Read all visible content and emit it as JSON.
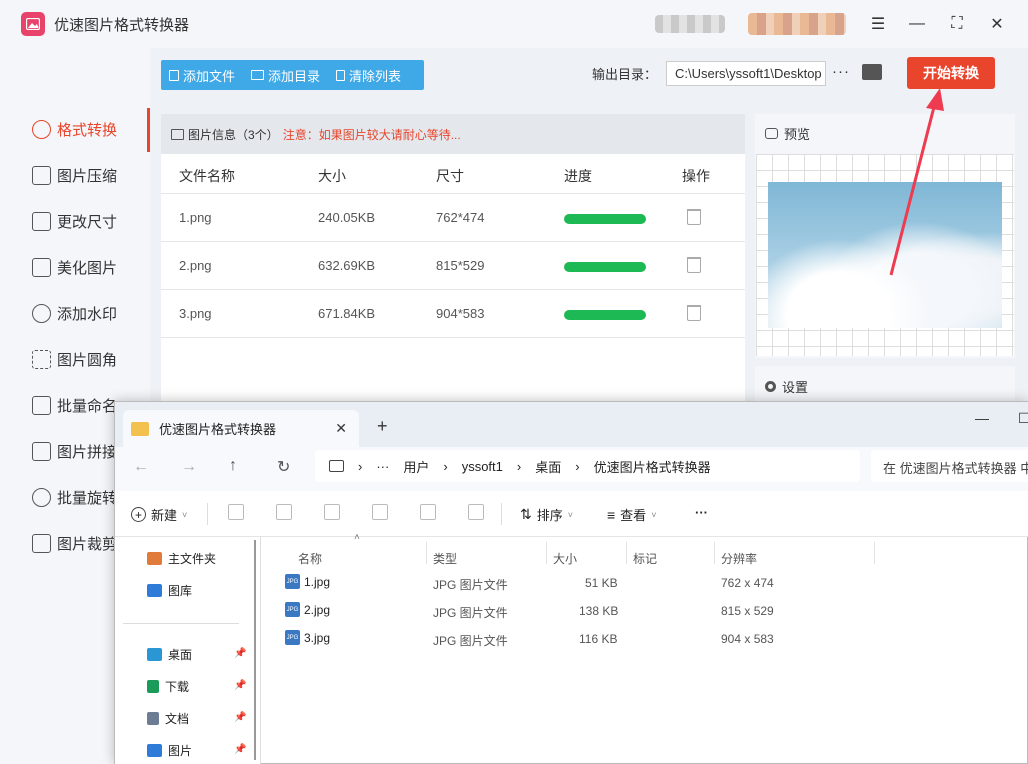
{
  "app": {
    "title": "优速图片格式转换器",
    "start_button": "开始转换",
    "output_label": "输出目录：",
    "output_path": "C:\\Users\\yssoft1\\Desktop",
    "more": "···",
    "window_buttons": {
      "menu": "☰",
      "minimize": "—",
      "maximize": "⛶",
      "close": "✕"
    }
  },
  "sidebar": {
    "items": [
      {
        "label": "格式转换",
        "active": true
      },
      {
        "label": "图片压缩"
      },
      {
        "label": "更改尺寸"
      },
      {
        "label": "美化图片"
      },
      {
        "label": "添加水印"
      },
      {
        "label": "图片圆角"
      },
      {
        "label": "批量命名"
      },
      {
        "label": "图片拼接"
      },
      {
        "label": "批量旋转"
      },
      {
        "label": "图片裁剪"
      }
    ]
  },
  "toolbar": {
    "add_file": "添加文件",
    "add_dir": "添加目录",
    "clear_list": "清除列表"
  },
  "file_list": {
    "info_label": "图片信息（3个）",
    "warning": "注意：如果图片较大请耐心等待...",
    "columns": [
      "文件名称",
      "大小",
      "尺寸",
      "进度",
      "操作"
    ],
    "rows": [
      {
        "name": "1.png",
        "size": "240.05KB",
        "dims": "762*474",
        "progress": 1.0
      },
      {
        "name": "2.png",
        "size": "632.69KB",
        "dims": "815*529",
        "progress": 1.0
      },
      {
        "name": "3.png",
        "size": "671.84KB",
        "dims": "904*583",
        "progress": 1.0
      }
    ]
  },
  "preview": {
    "label": "预览"
  },
  "settings": {
    "label": "设置"
  },
  "explorer": {
    "tab_title": "优速图片格式转换器",
    "tab_close": "✕",
    "tab_add": "+",
    "window_buttons": {
      "minimize": "—",
      "maximize": "☐"
    },
    "breadcrumb": [
      "用户",
      "yssoft1",
      "桌面",
      "优速图片格式转换器"
    ],
    "breadcrumb_more": "···",
    "search_placeholder": "在 优速图片格式转换器 中搜索",
    "commands": {
      "new": "新建",
      "sort": "排序",
      "view": "查看",
      "more": "···"
    },
    "nav": {
      "top": [
        {
          "label": "主文件夹",
          "color": "#e07b39"
        },
        {
          "label": "图库",
          "color": "#2f7bd8"
        }
      ],
      "pinned": [
        {
          "label": "桌面",
          "color": "#2a96d4"
        },
        {
          "label": "下载",
          "color": "#1a9b5a"
        },
        {
          "label": "文档",
          "color": "#6b7c93"
        },
        {
          "label": "图片",
          "color": "#2f7bd8"
        }
      ]
    },
    "columns": [
      "名称",
      "类型",
      "大小",
      "标记",
      "分辨率"
    ],
    "files": [
      {
        "name": "1.jpg",
        "type": "JPG 图片文件",
        "size": "51 KB",
        "res": "762 x 474"
      },
      {
        "name": "2.jpg",
        "type": "JPG 图片文件",
        "size": "138 KB",
        "res": "815 x 529"
      },
      {
        "name": "3.jpg",
        "type": "JPG 图片文件",
        "size": "116 KB",
        "res": "904 x 583"
      }
    ],
    "jpg_icon_label": "JPG"
  },
  "colors": {
    "accent": "#e8452c",
    "toolbar_blue": "#3fa9e8",
    "progress_green": "#1db954"
  }
}
